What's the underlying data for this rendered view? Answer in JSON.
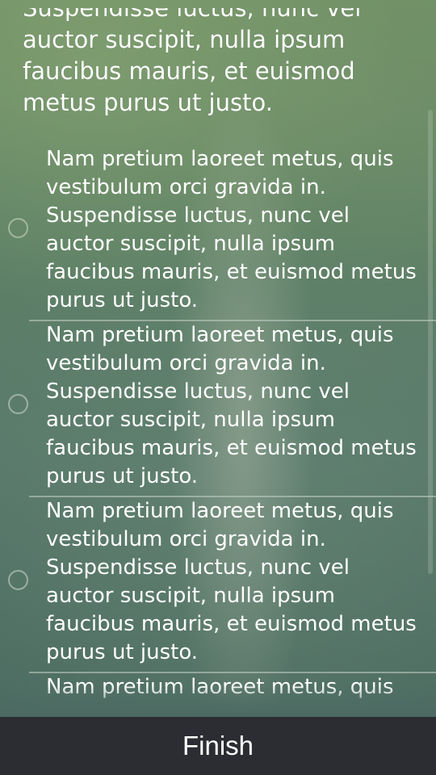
{
  "intro": {
    "cut_line": "Suspendisse luctus, nunc vel",
    "lines": [
      "auctor suscipit, nulla ipsum",
      "faucibus mauris, et euismod",
      "metus purus ut justo."
    ]
  },
  "options": [
    {
      "text": "Nam pretium laoreet metus, quis\nvestibulum orci gravida in.\nSuspendisse luctus, nunc vel\nauctor suscipit, nulla ipsum\nfaucibus mauris, et euismod metus\npurus ut justo.",
      "selected": false
    },
    {
      "text": "Nam pretium laoreet metus, quis\nvestibulum orci gravida in.\nSuspendisse luctus, nunc vel\nauctor suscipit, nulla ipsum\nfaucibus mauris, et euismod metus\npurus ut justo.",
      "selected": false
    },
    {
      "text": "Nam pretium laoreet metus, quis\nvestibulum orci gravida in.\nSuspendisse luctus, nunc vel\nauctor suscipit, nulla ipsum\nfaucibus mauris, et euismod metus\npurus ut justo.",
      "selected": false
    },
    {
      "text": "Nam pretium laoreet metus, quis",
      "selected": false
    }
  ],
  "footer": {
    "finish_label": "Finish"
  }
}
